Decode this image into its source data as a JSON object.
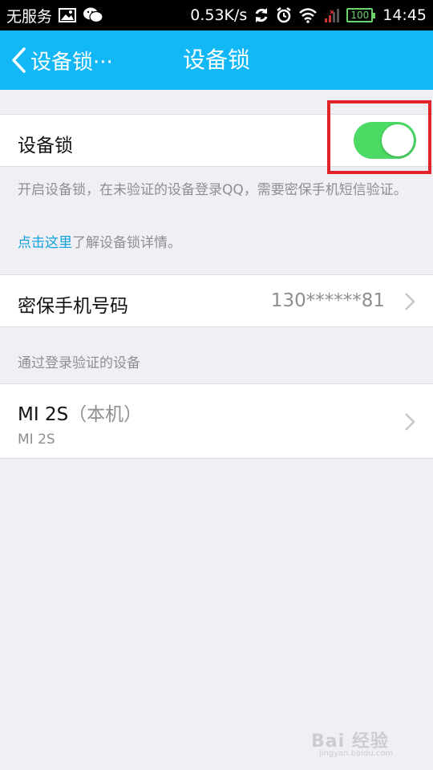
{
  "status_bar": {
    "carrier": "无服务",
    "speed": "0.53K/s",
    "battery": "100",
    "time": "14:45"
  },
  "title_bar": {
    "back_label": "设备锁···",
    "title": "设备锁"
  },
  "device_lock": {
    "label": "设备锁",
    "enabled": true,
    "toggle_color": "#4cd964",
    "description": "开启设备锁，在未验证的设备登录QQ，需要密保手机短信验证。",
    "link_text": "点击这里",
    "link_suffix": "了解设备锁详情。"
  },
  "phone": {
    "label": "密保手机号码",
    "value": "130******81"
  },
  "verified_devices": {
    "header": "通过登录验证的设备",
    "items": [
      {
        "name": "MI 2S",
        "tag": "（本机）",
        "model": "MI 2S"
      }
    ]
  },
  "watermark": {
    "text": "Bai 经验",
    "sub": "jingyan.baidu.com"
  },
  "colors": {
    "accent": "#12b7f5",
    "link": "#12a2e0",
    "highlight": "#e0242a"
  }
}
